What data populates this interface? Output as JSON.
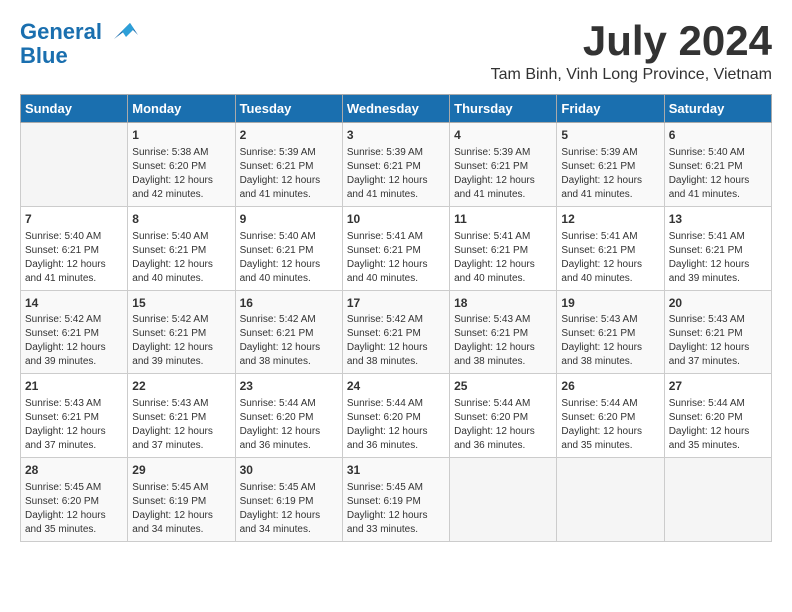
{
  "logo": {
    "line1": "General",
    "line2": "Blue"
  },
  "title": "July 2024",
  "location": "Tam Binh, Vinh Long Province, Vietnam",
  "weekdays": [
    "Sunday",
    "Monday",
    "Tuesday",
    "Wednesday",
    "Thursday",
    "Friday",
    "Saturday"
  ],
  "weeks": [
    [
      {
        "day": "",
        "sunrise": "",
        "sunset": "",
        "daylight": ""
      },
      {
        "day": "1",
        "sunrise": "Sunrise: 5:38 AM",
        "sunset": "Sunset: 6:20 PM",
        "daylight": "Daylight: 12 hours and 42 minutes."
      },
      {
        "day": "2",
        "sunrise": "Sunrise: 5:39 AM",
        "sunset": "Sunset: 6:21 PM",
        "daylight": "Daylight: 12 hours and 41 minutes."
      },
      {
        "day": "3",
        "sunrise": "Sunrise: 5:39 AM",
        "sunset": "Sunset: 6:21 PM",
        "daylight": "Daylight: 12 hours and 41 minutes."
      },
      {
        "day": "4",
        "sunrise": "Sunrise: 5:39 AM",
        "sunset": "Sunset: 6:21 PM",
        "daylight": "Daylight: 12 hours and 41 minutes."
      },
      {
        "day": "5",
        "sunrise": "Sunrise: 5:39 AM",
        "sunset": "Sunset: 6:21 PM",
        "daylight": "Daylight: 12 hours and 41 minutes."
      },
      {
        "day": "6",
        "sunrise": "Sunrise: 5:40 AM",
        "sunset": "Sunset: 6:21 PM",
        "daylight": "Daylight: 12 hours and 41 minutes."
      }
    ],
    [
      {
        "day": "7",
        "sunrise": "Sunrise: 5:40 AM",
        "sunset": "Sunset: 6:21 PM",
        "daylight": "Daylight: 12 hours and 41 minutes."
      },
      {
        "day": "8",
        "sunrise": "Sunrise: 5:40 AM",
        "sunset": "Sunset: 6:21 PM",
        "daylight": "Daylight: 12 hours and 40 minutes."
      },
      {
        "day": "9",
        "sunrise": "Sunrise: 5:40 AM",
        "sunset": "Sunset: 6:21 PM",
        "daylight": "Daylight: 12 hours and 40 minutes."
      },
      {
        "day": "10",
        "sunrise": "Sunrise: 5:41 AM",
        "sunset": "Sunset: 6:21 PM",
        "daylight": "Daylight: 12 hours and 40 minutes."
      },
      {
        "day": "11",
        "sunrise": "Sunrise: 5:41 AM",
        "sunset": "Sunset: 6:21 PM",
        "daylight": "Daylight: 12 hours and 40 minutes."
      },
      {
        "day": "12",
        "sunrise": "Sunrise: 5:41 AM",
        "sunset": "Sunset: 6:21 PM",
        "daylight": "Daylight: 12 hours and 40 minutes."
      },
      {
        "day": "13",
        "sunrise": "Sunrise: 5:41 AM",
        "sunset": "Sunset: 6:21 PM",
        "daylight": "Daylight: 12 hours and 39 minutes."
      }
    ],
    [
      {
        "day": "14",
        "sunrise": "Sunrise: 5:42 AM",
        "sunset": "Sunset: 6:21 PM",
        "daylight": "Daylight: 12 hours and 39 minutes."
      },
      {
        "day": "15",
        "sunrise": "Sunrise: 5:42 AM",
        "sunset": "Sunset: 6:21 PM",
        "daylight": "Daylight: 12 hours and 39 minutes."
      },
      {
        "day": "16",
        "sunrise": "Sunrise: 5:42 AM",
        "sunset": "Sunset: 6:21 PM",
        "daylight": "Daylight: 12 hours and 38 minutes."
      },
      {
        "day": "17",
        "sunrise": "Sunrise: 5:42 AM",
        "sunset": "Sunset: 6:21 PM",
        "daylight": "Daylight: 12 hours and 38 minutes."
      },
      {
        "day": "18",
        "sunrise": "Sunrise: 5:43 AM",
        "sunset": "Sunset: 6:21 PM",
        "daylight": "Daylight: 12 hours and 38 minutes."
      },
      {
        "day": "19",
        "sunrise": "Sunrise: 5:43 AM",
        "sunset": "Sunset: 6:21 PM",
        "daylight": "Daylight: 12 hours and 38 minutes."
      },
      {
        "day": "20",
        "sunrise": "Sunrise: 5:43 AM",
        "sunset": "Sunset: 6:21 PM",
        "daylight": "Daylight: 12 hours and 37 minutes."
      }
    ],
    [
      {
        "day": "21",
        "sunrise": "Sunrise: 5:43 AM",
        "sunset": "Sunset: 6:21 PM",
        "daylight": "Daylight: 12 hours and 37 minutes."
      },
      {
        "day": "22",
        "sunrise": "Sunrise: 5:43 AM",
        "sunset": "Sunset: 6:21 PM",
        "daylight": "Daylight: 12 hours and 37 minutes."
      },
      {
        "day": "23",
        "sunrise": "Sunrise: 5:44 AM",
        "sunset": "Sunset: 6:20 PM",
        "daylight": "Daylight: 12 hours and 36 minutes."
      },
      {
        "day": "24",
        "sunrise": "Sunrise: 5:44 AM",
        "sunset": "Sunset: 6:20 PM",
        "daylight": "Daylight: 12 hours and 36 minutes."
      },
      {
        "day": "25",
        "sunrise": "Sunrise: 5:44 AM",
        "sunset": "Sunset: 6:20 PM",
        "daylight": "Daylight: 12 hours and 36 minutes."
      },
      {
        "day": "26",
        "sunrise": "Sunrise: 5:44 AM",
        "sunset": "Sunset: 6:20 PM",
        "daylight": "Daylight: 12 hours and 35 minutes."
      },
      {
        "day": "27",
        "sunrise": "Sunrise: 5:44 AM",
        "sunset": "Sunset: 6:20 PM",
        "daylight": "Daylight: 12 hours and 35 minutes."
      }
    ],
    [
      {
        "day": "28",
        "sunrise": "Sunrise: 5:45 AM",
        "sunset": "Sunset: 6:20 PM",
        "daylight": "Daylight: 12 hours and 35 minutes."
      },
      {
        "day": "29",
        "sunrise": "Sunrise: 5:45 AM",
        "sunset": "Sunset: 6:19 PM",
        "daylight": "Daylight: 12 hours and 34 minutes."
      },
      {
        "day": "30",
        "sunrise": "Sunrise: 5:45 AM",
        "sunset": "Sunset: 6:19 PM",
        "daylight": "Daylight: 12 hours and 34 minutes."
      },
      {
        "day": "31",
        "sunrise": "Sunrise: 5:45 AM",
        "sunset": "Sunset: 6:19 PM",
        "daylight": "Daylight: 12 hours and 33 minutes."
      },
      {
        "day": "",
        "sunrise": "",
        "sunset": "",
        "daylight": ""
      },
      {
        "day": "",
        "sunrise": "",
        "sunset": "",
        "daylight": ""
      },
      {
        "day": "",
        "sunrise": "",
        "sunset": "",
        "daylight": ""
      }
    ]
  ]
}
